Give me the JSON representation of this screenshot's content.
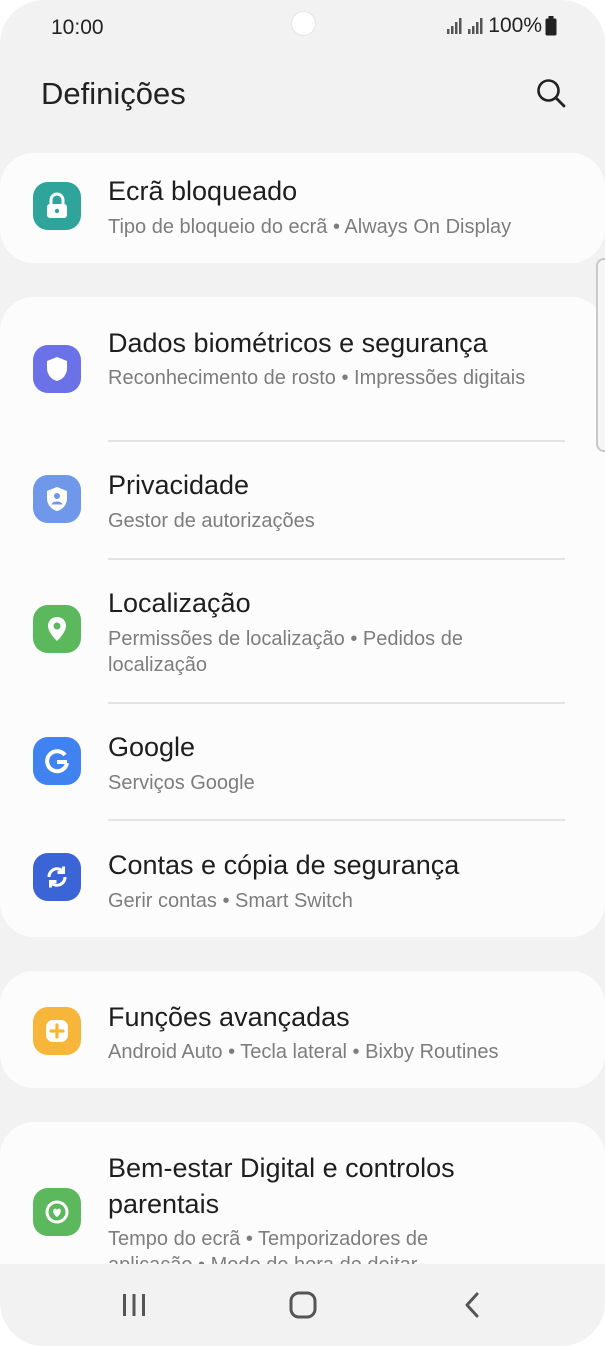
{
  "status_bar": {
    "time": "10:00",
    "battery": "100%"
  },
  "header": {
    "title": "Definições"
  },
  "icons": {
    "search": "search-icon",
    "lock": "lock-icon",
    "biometrics": "shield-icon",
    "privacy": "privacy-shield-icon",
    "location": "location-pin-icon",
    "google": "google-g-icon",
    "accounts": "sync-icon",
    "advanced": "puzzle-plus-icon",
    "wellbeing": "heart-circle-icon"
  },
  "colors": {
    "lock": "#2ea49b",
    "biometrics": "#6b72e8",
    "privacy": "#6f97ea",
    "location": "#5cb85c",
    "google": "#3f82f0",
    "accounts": "#3b64d6",
    "advanced": "#f7b53a",
    "wellbeing": "#5cb85c"
  },
  "items": [
    {
      "title": "Ecrã bloqueado",
      "subtitle": "Tipo de bloqueio do ecrã  •  Always On Display"
    },
    {
      "title": "Dados biométricos e segurança",
      "subtitle": "Reconhecimento de rosto  •  Impressões digitais"
    },
    {
      "title": "Privacidade",
      "subtitle": "Gestor de autorizações"
    },
    {
      "title": "Localização",
      "subtitle": "Permissões de localização  •  Pedidos de localização"
    },
    {
      "title": "Google",
      "subtitle": "Serviços Google"
    },
    {
      "title": "Contas e cópia de segurança",
      "subtitle": "Gerir contas  •  Smart Switch"
    },
    {
      "title": "Funções avançadas",
      "subtitle": "Android Auto  •  Tecla lateral  •  Bixby Routines"
    },
    {
      "title": "Bem-estar Digital e controlos parentais",
      "subtitle": "Tempo do ecrã  •  Temporizadores de aplicação  •  Modo de hora de deitar"
    }
  ]
}
